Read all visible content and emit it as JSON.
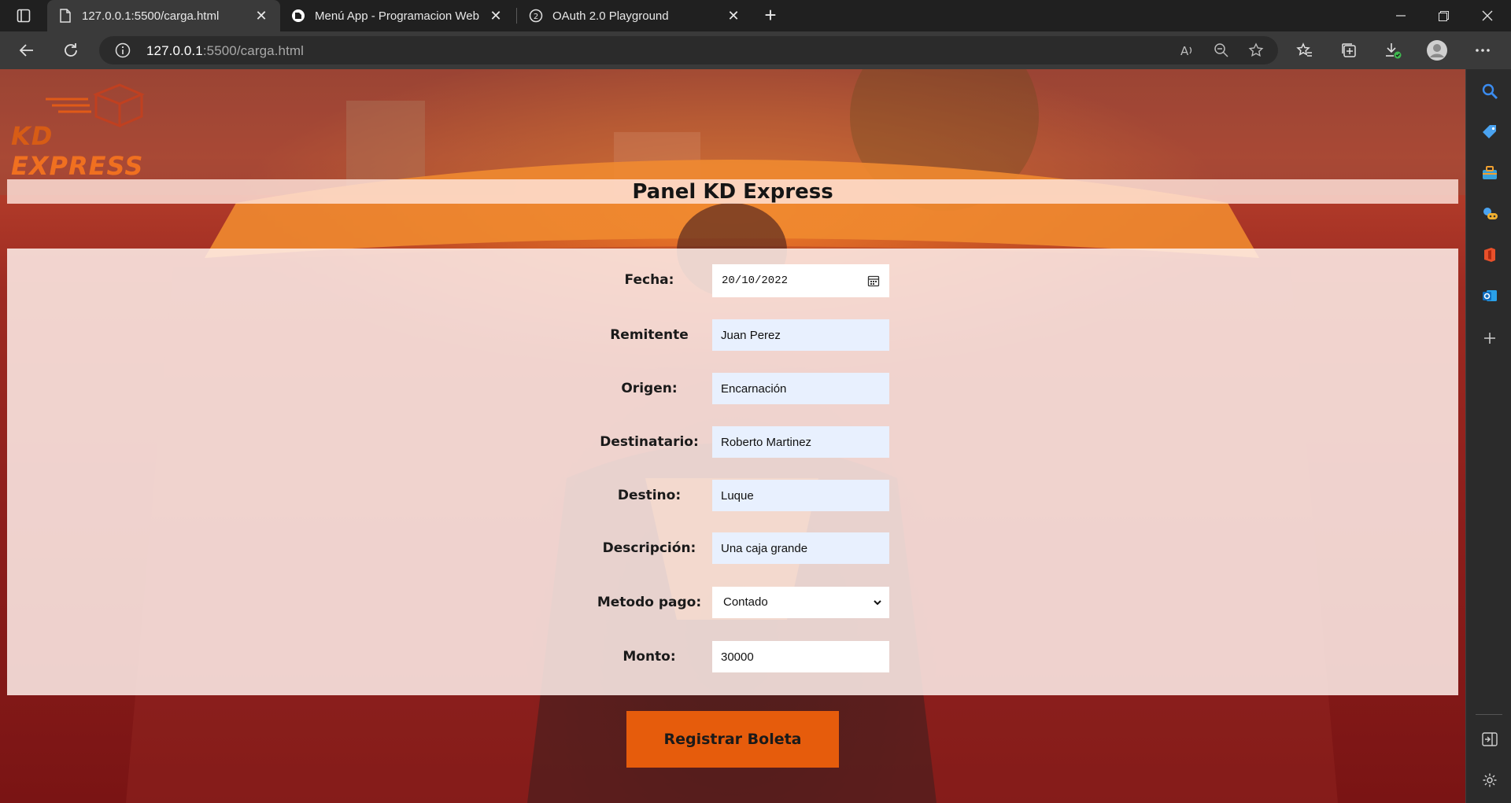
{
  "browser": {
    "tabs": [
      {
        "title": "127.0.0.1:5500/carga.html",
        "active": true,
        "icon": "page-icon"
      },
      {
        "title": "Menú App - Programacion Web",
        "active": false,
        "icon": "notion-icon"
      },
      {
        "title": "OAuth 2.0 Playground",
        "active": false,
        "icon": "oauth-playground-icon"
      }
    ],
    "url_host": "127.0.0.1",
    "url_rest": ":5500/carga.html"
  },
  "page": {
    "logo_prefix": "KD",
    "logo_word": "EXPRESS",
    "title": "Panel KD Express",
    "fields": {
      "fecha": {
        "label": "Fecha:",
        "value": "20/10/2022"
      },
      "remitente": {
        "label": "Remitente",
        "value": "Juan Perez"
      },
      "origen": {
        "label": "Origen:",
        "value": "Encarnación"
      },
      "destinatario": {
        "label": "Destinatario:",
        "value": "Roberto Martinez"
      },
      "destino": {
        "label": "Destino:",
        "value": "Luque"
      },
      "descripcion": {
        "label": "Descripción:",
        "value": "Una caja grande"
      },
      "metodo_pago": {
        "label": "Metodo pago:",
        "value": "Contado"
      },
      "monto": {
        "label": "Monto:",
        "value": "30000"
      }
    },
    "submit_label": "Registrar Boleta"
  },
  "colors": {
    "accent": "#e65c0c",
    "autofill": "#e8f0fe",
    "browser_bg": "#202020"
  }
}
